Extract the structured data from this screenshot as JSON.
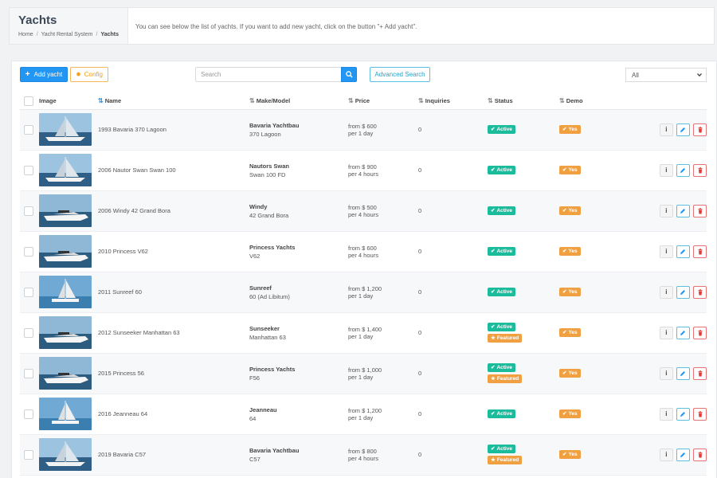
{
  "header": {
    "title": "Yachts",
    "breadcrumb": [
      "Home",
      "Yacht Rental System",
      "Yachts"
    ],
    "description": "You can see below the list of yachts. If you want to add new yacht, click on the button \"+ Add yacht\"."
  },
  "toolbar": {
    "add_label": "Add yacht",
    "add_icon": "+",
    "config_label": "Config",
    "config_icon": "✹",
    "search_placeholder": "Search",
    "advanced_label": "Advanced Search",
    "filter_value": "All"
  },
  "columns": {
    "image": "Image",
    "name": "Name",
    "make": "Make/Model",
    "price": "Price",
    "inquiries": "Inquiries",
    "status": "Status",
    "demo": "Demo"
  },
  "yachts": [
    {
      "name": "1993 Bavaria 370 Lagoon",
      "make": "Bavaria Yachtbau",
      "model": "370 Lagoon",
      "price": "from $ 600",
      "period": "per 1 day",
      "inquiries": "0",
      "status": "Active",
      "featured": "",
      "demo": "Yes",
      "image": "sailboat"
    },
    {
      "name": "2006 Nautor Swan Swan 100",
      "make": "Nautors Swan",
      "model": "Swan 100 FD",
      "price": "from $ 900",
      "period": "per 4 hours",
      "inquiries": "0",
      "status": "Active",
      "featured": "",
      "demo": "Yes",
      "image": "sailboat"
    },
    {
      "name": "2006 Windy 42 Grand Bora",
      "make": "Windy",
      "model": "42 Grand Bora",
      "price": "from $ 500",
      "period": "per 4 hours",
      "inquiries": "0",
      "status": "Active",
      "featured": "",
      "demo": "Yes",
      "image": "motor"
    },
    {
      "name": "2010 Princess V62",
      "make": "Princess Yachts",
      "model": "V62",
      "price": "from $ 600",
      "period": "per 4 hours",
      "inquiries": "0",
      "status": "Active",
      "featured": "",
      "demo": "Yes",
      "image": "motor"
    },
    {
      "name": "2011 Sunreef 60",
      "make": "Sunreef",
      "model": "60 (Ad Libitum)",
      "price": "from $ 1,200",
      "period": "per 1 day",
      "inquiries": "0",
      "status": "Active",
      "featured": "",
      "demo": "Yes",
      "image": "catamaran"
    },
    {
      "name": "2012 Sunseeker Manhattan 63",
      "make": "Sunseeker",
      "model": "Manhattan 63",
      "price": "from $ 1,400",
      "period": "per 1 day",
      "inquiries": "0",
      "status": "Active",
      "featured": "Featured",
      "demo": "Yes",
      "image": "motor"
    },
    {
      "name": "2015 Princess 56",
      "make": "Princess Yachts",
      "model": "F56",
      "price": "from $ 1,000",
      "period": "per 1 day",
      "inquiries": "0",
      "status": "Active",
      "featured": "Featured",
      "demo": "Yes",
      "image": "motor"
    },
    {
      "name": "2016 Jeanneau 64",
      "make": "Jeanneau",
      "model": "64",
      "price": "from $ 1,200",
      "period": "per 1 day",
      "inquiries": "0",
      "status": "Active",
      "featured": "",
      "demo": "Yes",
      "image": "catamaran"
    },
    {
      "name": "2019 Bavaria C57",
      "make": "Bavaria Yachtbau",
      "model": "C57",
      "price": "from $ 800",
      "period": "per 4 hours",
      "inquiries": "0",
      "status": "Active",
      "featured": "Featured",
      "demo": "Yes",
      "image": "sailboat"
    }
  ],
  "colors": {
    "primary": "#2196f3",
    "active": "#1abc9c",
    "featured": "#f0a040",
    "danger": "#e53935"
  }
}
